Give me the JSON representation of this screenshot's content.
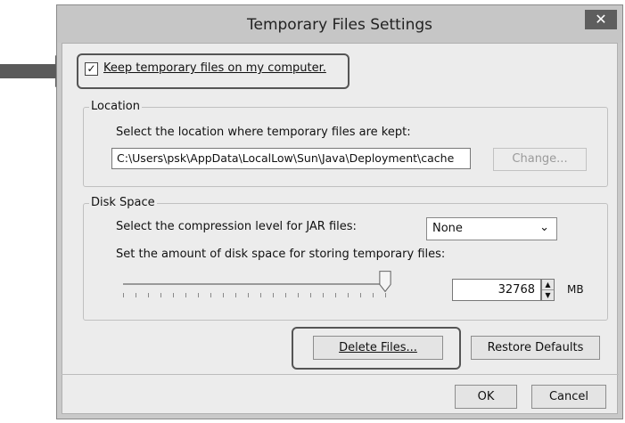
{
  "window": {
    "title": "Temporary Files Settings",
    "close_glyph": "✕"
  },
  "keep_files": {
    "label": "Keep temporary files on my computer.",
    "checked": true,
    "check_glyph": "✓"
  },
  "location": {
    "legend": "Location",
    "prompt": "Select the location where temporary files are kept:",
    "path": "C:\\Users\\psk\\AppData\\LocalLow\\Sun\\Java\\Deployment\\cache",
    "change_button": "Change..."
  },
  "disk_space": {
    "legend": "Disk Space",
    "compression_prompt": "Select the compression level for JAR files:",
    "compression_value": "None",
    "amount_prompt": "Set the amount of disk space for storing temporary files:",
    "amount_value": "32768",
    "unit": "MB"
  },
  "buttons": {
    "delete_files": "Delete Files...",
    "restore_defaults": "Restore Defaults",
    "ok": "OK",
    "cancel": "Cancel"
  },
  "annotations": {
    "arrow_color": "#5a5a5a",
    "highlight_color": "#555555"
  }
}
